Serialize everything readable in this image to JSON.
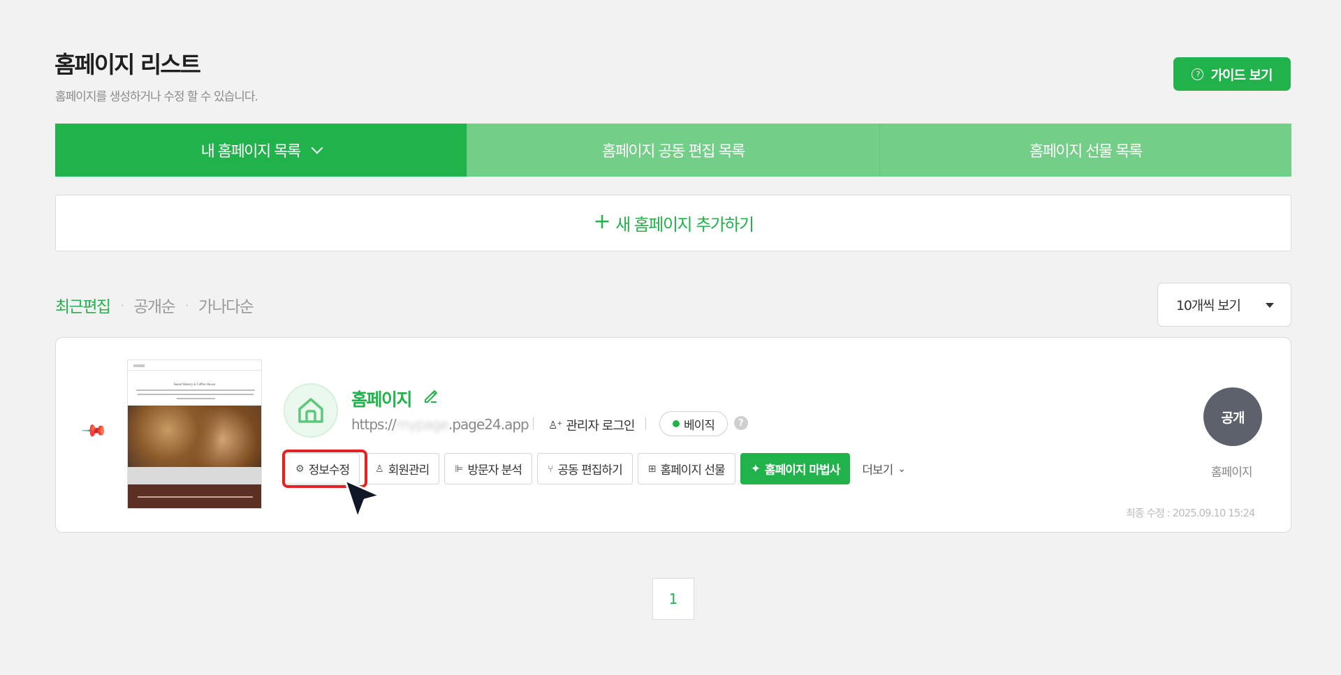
{
  "header": {
    "title": "홈페이지 리스트",
    "subtitle": "홈페이지를 생성하거나 수정 할 수 있습니다.",
    "guide_button": "가이드 보기",
    "guide_icon": "question-circle-icon"
  },
  "tabs": [
    {
      "label": "내 홈페이지 목록",
      "active": true
    },
    {
      "label": "홈페이지 공동 편집 목록",
      "active": false
    },
    {
      "label": "홈페이지 선물 목록",
      "active": false
    }
  ],
  "add_new": {
    "icon": "+",
    "label": "새 홈페이지 추가하기"
  },
  "sort": {
    "options": [
      "최근편집",
      "공개순",
      "가나다순"
    ],
    "active": "최근편집",
    "separator": "·"
  },
  "per_page": {
    "selected": "10개씩 보기"
  },
  "site": {
    "name": "홈페이지",
    "url_prefix": "https://",
    "url_blurred": "mypage",
    "url_suffix": ".page24.app",
    "admin_login": "관리자 로그인",
    "plan_badge": "베이직",
    "help": "?",
    "status": "공개",
    "status_label": "홈페이지",
    "last_modified": "최종 수정 : 2025.09.10 15:24",
    "thumbnail": {
      "title": "Sweet Bakery & Coffee House"
    },
    "actions": [
      {
        "label": "정보수정",
        "icon": "⚙"
      },
      {
        "label": "회원관리",
        "icon": "♙"
      },
      {
        "label": "방문자 분석",
        "icon": "⊫"
      },
      {
        "label": "공동 편집하기",
        "icon": "⑂"
      },
      {
        "label": "홈페이지 선물",
        "icon": "⊞"
      },
      {
        "label": "홈페이지 마법사",
        "icon": "✦"
      },
      {
        "label": "더보기",
        "icon": "⌄"
      }
    ]
  },
  "pagination": {
    "current": "1"
  },
  "colors": {
    "accent": "#21b24b",
    "accent_light": "#73cf87",
    "highlight": "#e5221f"
  }
}
